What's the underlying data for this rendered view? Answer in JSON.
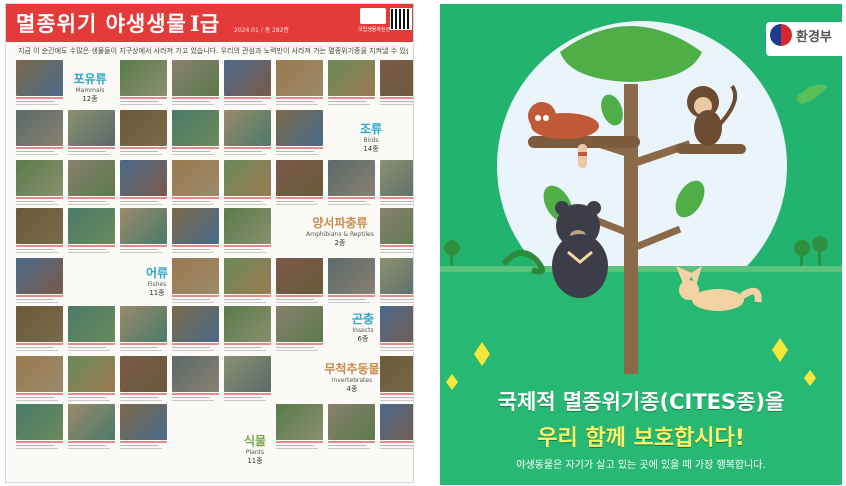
{
  "poster": {
    "title": "멸종위기 야생생물",
    "grade": "I급",
    "date_note": "2024.01 / 총 282종",
    "org": "국립생물자원관",
    "intro": "지금 이 순간에도 수많은 생물들이 지구상에서 사라져 가고 있습니다. 우리의 관심과 노력만이 사라져 가는 멸종위기종을 지켜낼 수 있습니다.",
    "groups": [
      {
        "key": "mammals",
        "name": "포유류",
        "english": "Mammals",
        "count": "12종"
      },
      {
        "key": "birds",
        "name": "조류",
        "english": "Birds",
        "count": "14종"
      },
      {
        "key": "amphibians",
        "name": "양서파충류",
        "english": "Amphibians & Reptiles",
        "count": "2종"
      },
      {
        "key": "fishes",
        "name": "어류",
        "english": "Fishes",
        "count": "11종"
      },
      {
        "key": "insects",
        "name": "곤충",
        "english": "Insects",
        "count": "6종"
      },
      {
        "key": "invertebrates",
        "name": "무척추동물",
        "english": "Invertebrates",
        "count": "4종"
      },
      {
        "key": "plants",
        "name": "식물",
        "english": "Plants",
        "count": "11종"
      }
    ],
    "colors": {
      "header": "#e43a3a",
      "group_text": "#2aa6c8"
    }
  },
  "illustration": {
    "ministry": "환경부",
    "headline_1": "국제적 멸종위기종(CITES종)을",
    "headline_2": "우리 함께 보호합시다!",
    "subtext": "야생동물은 자기가 살고 있는 곳에 있을 때 가장 행복합니다.",
    "icons": [
      "red-panda-icon",
      "monkey-icon",
      "sun-bear-icon",
      "fennec-fox-icon",
      "bird-icon",
      "snake-icon",
      "tree-icon"
    ],
    "colors": {
      "background": "#22b46e",
      "sky": "#e9f4fb",
      "headline_2": "#fff36b"
    }
  }
}
